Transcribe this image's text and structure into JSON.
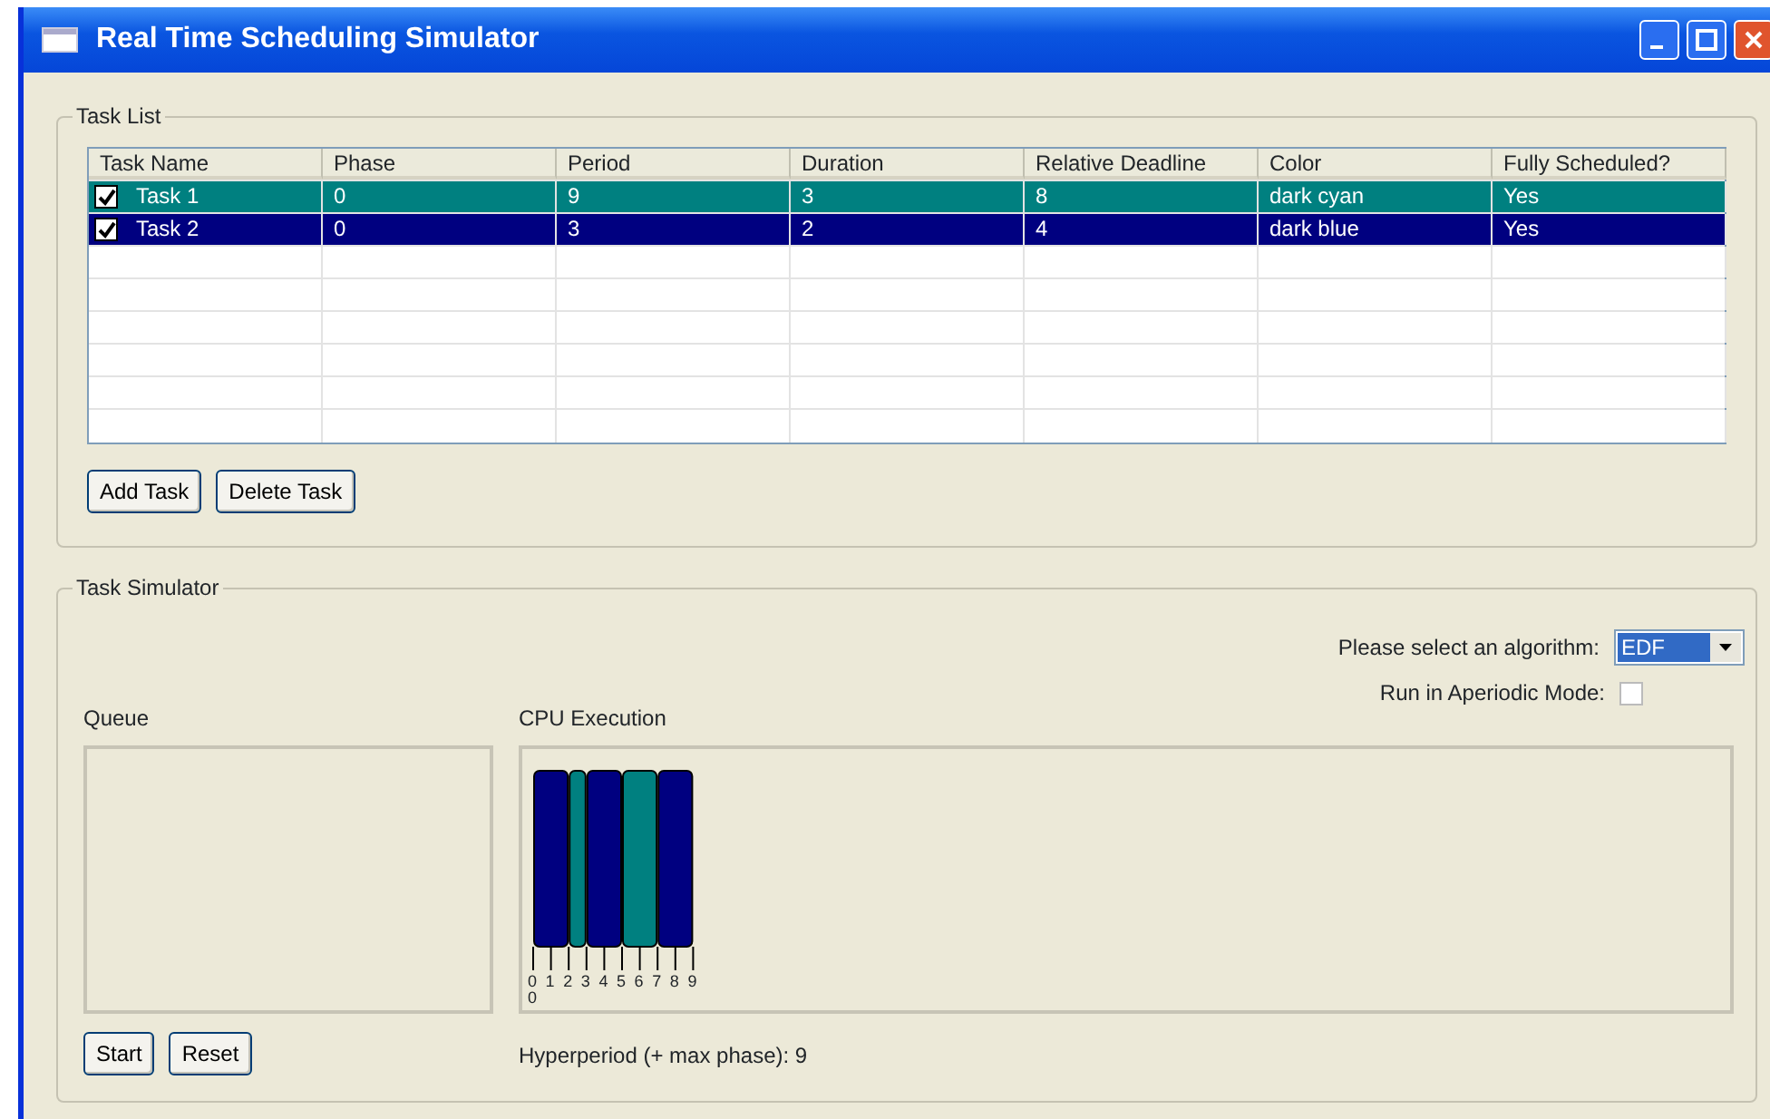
{
  "window": {
    "title": "Real Time Scheduling Simulator"
  },
  "task_list": {
    "title": "Task List",
    "columns": [
      "Task Name",
      "Phase",
      "Period",
      "Duration",
      "Relative Deadline",
      "Color",
      "Fully Scheduled?"
    ],
    "rows": [
      {
        "checked": true,
        "color": "#008080",
        "cells": [
          "Task 1",
          "0",
          "9",
          "3",
          "8",
          "dark cyan",
          "Yes"
        ]
      },
      {
        "checked": true,
        "color": "#000080",
        "cells": [
          "Task 2",
          "0",
          "3",
          "2",
          "4",
          "dark blue",
          "Yes"
        ]
      }
    ],
    "buttons": [
      "Add Task",
      "Delete Task"
    ]
  },
  "task_simulator": {
    "title": "Task Simulator",
    "algorithm_label": "Please select an algorithm:",
    "algorithm": "EDF",
    "aperiodic_label": "Run in Aperiodic Mode:",
    "aperiodic": false,
    "queue_label": "Queue",
    "cpu_label": "CPU Execution",
    "cpu_slots": [
      {
        "color": "#000080"
      },
      {
        "color": "#000080"
      },
      {
        "color": "#008080"
      },
      {
        "color": "#000080"
      },
      {
        "color": "#000080"
      },
      {
        "color": "#008080"
      },
      {
        "color": "#008080"
      },
      {
        "color": "#000080"
      },
      {
        "color": "#000080"
      }
    ],
    "tick_labels": [
      "0",
      "1",
      "2",
      "3",
      "4",
      "5",
      "6",
      "7",
      "8",
      "9"
    ],
    "extra_tick_label": "0",
    "buttons": [
      "Start",
      "Reset"
    ],
    "hyperperiod_label": "Hyperperiod (+ max phase):",
    "hyperperiod": "9"
  }
}
